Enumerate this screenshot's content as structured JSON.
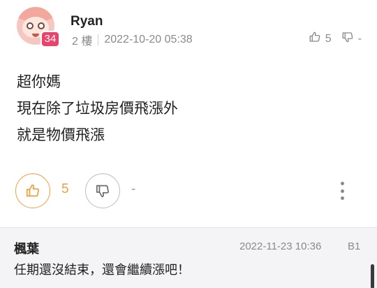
{
  "post": {
    "username": "Ryan",
    "level": "34",
    "floor": "2 樓",
    "timestamp": "2022-10-20 05:38",
    "header_likes": "5",
    "header_dislikes": "-",
    "content_lines": [
      "超你媽",
      "現在除了垃圾房價飛漲外",
      "就是物價飛漲"
    ],
    "like_count": "5",
    "dislike_count": "-"
  },
  "reply": {
    "author": "楓葉",
    "timestamp": "2022-11-23 10:36",
    "floor": "B1",
    "text": "任期還沒結束，還會繼續漲吧！"
  },
  "colors": {
    "like_accent": "#f0a03b",
    "level_badge": "#e8436a",
    "reply_bg": "#f4f4f6"
  },
  "icons": {
    "like": "thumbs-up-icon",
    "dislike": "thumbs-down-icon",
    "more": "more-vertical-icon"
  }
}
